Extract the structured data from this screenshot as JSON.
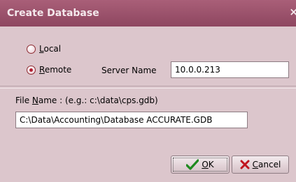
{
  "window": {
    "title": "Create Database",
    "close_glyph": "×"
  },
  "connection": {
    "local": {
      "label_prefix": "",
      "accesskey": "L",
      "label_rest": "ocal",
      "checked": false
    },
    "remote": {
      "accesskey": "R",
      "label_rest": "emote",
      "checked": true
    },
    "server_name_label": "Server Name",
    "server_name_value": "10.0.0.213"
  },
  "file": {
    "label_prefix": "File ",
    "label_accesskey": "N",
    "label_rest": "ame :  (e.g.: c:\\data\\cps.gdb)",
    "value": "C:\\Data\\Accounting\\Database ACCURATE.GDB"
  },
  "buttons": {
    "ok": {
      "accesskey": "O",
      "label_rest": "K",
      "icon": "check-icon"
    },
    "cancel": {
      "accesskey": "C",
      "label_rest": "ancel",
      "icon": "cancel-x-icon"
    }
  },
  "colors": {
    "titlebar": "#9a516b",
    "dialog_bg": "#dcc6cc",
    "check_green": "#1f8a1f",
    "cancel_red": "#c0141e"
  }
}
